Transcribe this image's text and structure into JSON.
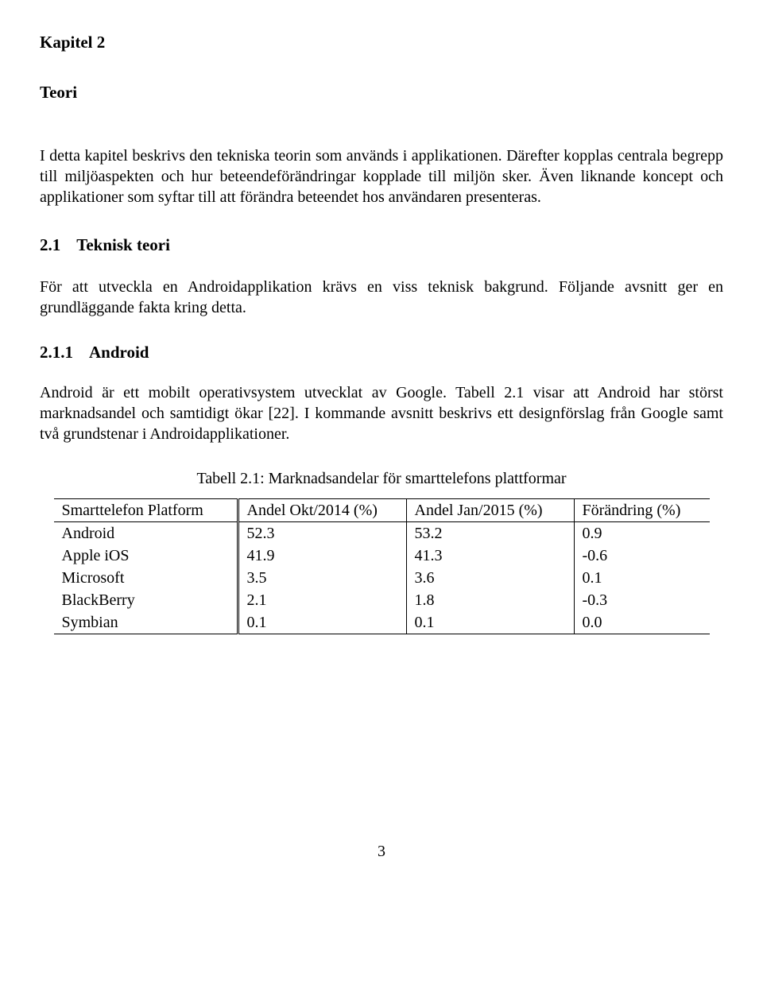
{
  "chapter": {
    "label": "Kapitel 2",
    "title": "Teori"
  },
  "intro_para": "I detta kapitel beskrivs den tekniska teorin som används i applikationen. Därefter kopplas centrala begrepp till miljöaspekten och hur beteendeförändringar kopplade till miljön sker. Även liknande koncept och applikationer som syftar till att förändra beteendet hos användaren presenteras.",
  "section_2_1": {
    "number": "2.1",
    "title": "Teknisk teori",
    "para": "För att utveckla en Androidapplikation krävs en viss teknisk bakgrund. Följande avsnitt ger en grundläggande fakta kring detta."
  },
  "section_2_1_1": {
    "number": "2.1.1",
    "title": "Android",
    "para": "Android är ett mobilt operativsystem utvecklat av Google. Tabell 2.1 visar att Android har störst marknadsandel och samtidigt ökar [22]. I kommande avsnitt beskrivs ett designförslag från Google samt två grundstenar i Androidapplikationer."
  },
  "table": {
    "caption": "Tabell 2.1: Marknadsandelar för smarttelefons plattformar",
    "headers": {
      "platform": "Smarttelefon Platform",
      "okt": "Andel Okt/2014 (%)",
      "jan": "Andel Jan/2015 (%)",
      "change": "Förändring (%)"
    }
  },
  "chart_data": {
    "type": "table",
    "title": "Tabell 2.1: Marknadsandelar för smarttelefons plattformar",
    "columns": [
      "Smarttelefon Platform",
      "Andel Okt/2014 (%)",
      "Andel Jan/2015 (%)",
      "Förändring (%)"
    ],
    "rows": [
      {
        "platform": "Android",
        "okt": "52.3",
        "jan": "53.2",
        "change": "0.9"
      },
      {
        "platform": "Apple iOS",
        "okt": "41.9",
        "jan": "41.3",
        "change": "-0.6"
      },
      {
        "platform": "Microsoft",
        "okt": "3.5",
        "jan": "3.6",
        "change": "0.1"
      },
      {
        "platform": "BlackBerry",
        "okt": "2.1",
        "jan": "1.8",
        "change": "-0.3"
      },
      {
        "platform": "Symbian",
        "okt": "0.1",
        "jan": "0.1",
        "change": "0.0"
      }
    ]
  },
  "page_number": "3"
}
